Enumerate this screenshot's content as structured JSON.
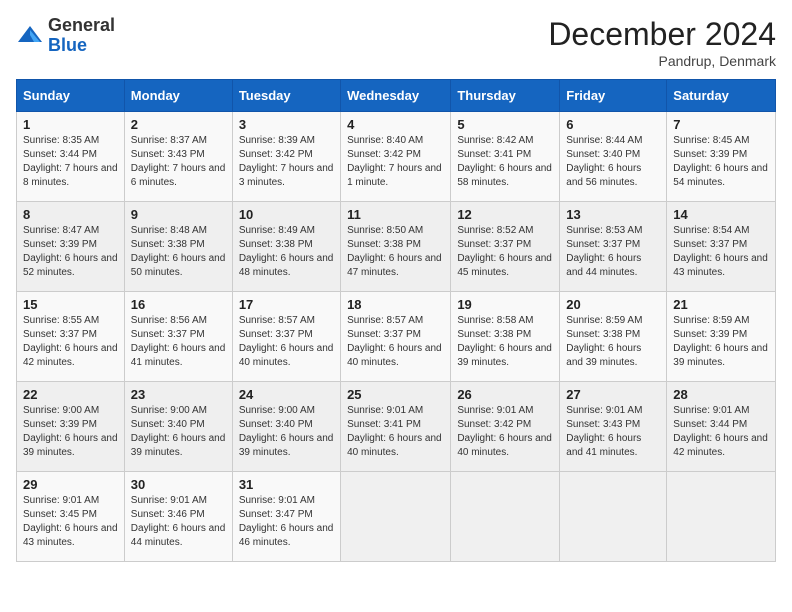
{
  "header": {
    "logo_line1": "General",
    "logo_line2": "Blue",
    "month_title": "December 2024",
    "location": "Pandrup, Denmark"
  },
  "weekdays": [
    "Sunday",
    "Monday",
    "Tuesday",
    "Wednesday",
    "Thursday",
    "Friday",
    "Saturday"
  ],
  "weeks": [
    [
      {
        "day": "1",
        "sunrise": "8:35 AM",
        "sunset": "3:44 PM",
        "daylight": "7 hours and 8 minutes."
      },
      {
        "day": "2",
        "sunrise": "8:37 AM",
        "sunset": "3:43 PM",
        "daylight": "7 hours and 6 minutes."
      },
      {
        "day": "3",
        "sunrise": "8:39 AM",
        "sunset": "3:42 PM",
        "daylight": "7 hours and 3 minutes."
      },
      {
        "day": "4",
        "sunrise": "8:40 AM",
        "sunset": "3:42 PM",
        "daylight": "7 hours and 1 minute."
      },
      {
        "day": "5",
        "sunrise": "8:42 AM",
        "sunset": "3:41 PM",
        "daylight": "6 hours and 58 minutes."
      },
      {
        "day": "6",
        "sunrise": "8:44 AM",
        "sunset": "3:40 PM",
        "daylight": "6 hours and 56 minutes."
      },
      {
        "day": "7",
        "sunrise": "8:45 AM",
        "sunset": "3:39 PM",
        "daylight": "6 hours and 54 minutes."
      }
    ],
    [
      {
        "day": "8",
        "sunrise": "8:47 AM",
        "sunset": "3:39 PM",
        "daylight": "6 hours and 52 minutes."
      },
      {
        "day": "9",
        "sunrise": "8:48 AM",
        "sunset": "3:38 PM",
        "daylight": "6 hours and 50 minutes."
      },
      {
        "day": "10",
        "sunrise": "8:49 AM",
        "sunset": "3:38 PM",
        "daylight": "6 hours and 48 minutes."
      },
      {
        "day": "11",
        "sunrise": "8:50 AM",
        "sunset": "3:38 PM",
        "daylight": "6 hours and 47 minutes."
      },
      {
        "day": "12",
        "sunrise": "8:52 AM",
        "sunset": "3:37 PM",
        "daylight": "6 hours and 45 minutes."
      },
      {
        "day": "13",
        "sunrise": "8:53 AM",
        "sunset": "3:37 PM",
        "daylight": "6 hours and 44 minutes."
      },
      {
        "day": "14",
        "sunrise": "8:54 AM",
        "sunset": "3:37 PM",
        "daylight": "6 hours and 43 minutes."
      }
    ],
    [
      {
        "day": "15",
        "sunrise": "8:55 AM",
        "sunset": "3:37 PM",
        "daylight": "6 hours and 42 minutes."
      },
      {
        "day": "16",
        "sunrise": "8:56 AM",
        "sunset": "3:37 PM",
        "daylight": "6 hours and 41 minutes."
      },
      {
        "day": "17",
        "sunrise": "8:57 AM",
        "sunset": "3:37 PM",
        "daylight": "6 hours and 40 minutes."
      },
      {
        "day": "18",
        "sunrise": "8:57 AM",
        "sunset": "3:37 PM",
        "daylight": "6 hours and 40 minutes."
      },
      {
        "day": "19",
        "sunrise": "8:58 AM",
        "sunset": "3:38 PM",
        "daylight": "6 hours and 39 minutes."
      },
      {
        "day": "20",
        "sunrise": "8:59 AM",
        "sunset": "3:38 PM",
        "daylight": "6 hours and 39 minutes."
      },
      {
        "day": "21",
        "sunrise": "8:59 AM",
        "sunset": "3:39 PM",
        "daylight": "6 hours and 39 minutes."
      }
    ],
    [
      {
        "day": "22",
        "sunrise": "9:00 AM",
        "sunset": "3:39 PM",
        "daylight": "6 hours and 39 minutes."
      },
      {
        "day": "23",
        "sunrise": "9:00 AM",
        "sunset": "3:40 PM",
        "daylight": "6 hours and 39 minutes."
      },
      {
        "day": "24",
        "sunrise": "9:00 AM",
        "sunset": "3:40 PM",
        "daylight": "6 hours and 39 minutes."
      },
      {
        "day": "25",
        "sunrise": "9:01 AM",
        "sunset": "3:41 PM",
        "daylight": "6 hours and 40 minutes."
      },
      {
        "day": "26",
        "sunrise": "9:01 AM",
        "sunset": "3:42 PM",
        "daylight": "6 hours and 40 minutes."
      },
      {
        "day": "27",
        "sunrise": "9:01 AM",
        "sunset": "3:43 PM",
        "daylight": "6 hours and 41 minutes."
      },
      {
        "day": "28",
        "sunrise": "9:01 AM",
        "sunset": "3:44 PM",
        "daylight": "6 hours and 42 minutes."
      }
    ],
    [
      {
        "day": "29",
        "sunrise": "9:01 AM",
        "sunset": "3:45 PM",
        "daylight": "6 hours and 43 minutes."
      },
      {
        "day": "30",
        "sunrise": "9:01 AM",
        "sunset": "3:46 PM",
        "daylight": "6 hours and 44 minutes."
      },
      {
        "day": "31",
        "sunrise": "9:01 AM",
        "sunset": "3:47 PM",
        "daylight": "6 hours and 46 minutes."
      },
      null,
      null,
      null,
      null
    ]
  ]
}
